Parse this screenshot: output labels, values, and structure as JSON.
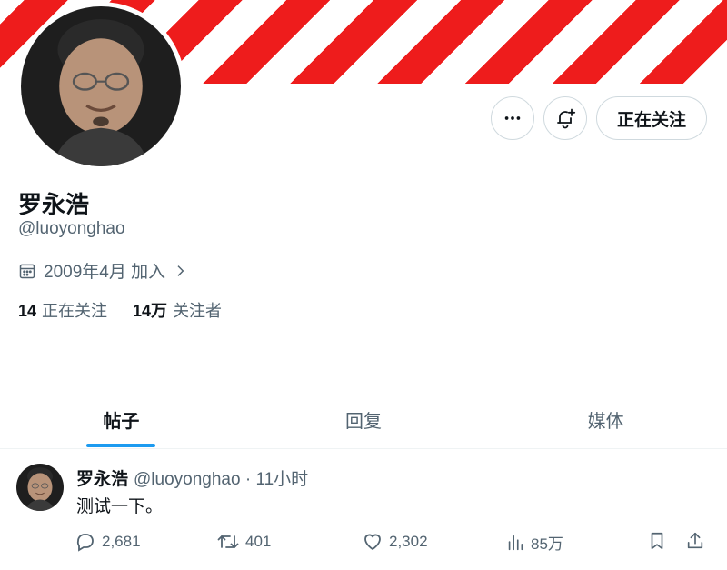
{
  "profile": {
    "name": "罗永浩",
    "handle": "@luoyonghao",
    "joined": "2009年4月 加入",
    "following_count": "14",
    "following_label": "正在关注",
    "followers_count": "14万",
    "followers_label": "关注者"
  },
  "actions": {
    "follow_label": "正在关注"
  },
  "tabs": [
    {
      "label": "帖子",
      "active": true
    },
    {
      "label": "回复",
      "active": false
    },
    {
      "label": "媒体",
      "active": false
    }
  ],
  "post": {
    "author": "罗永浩",
    "meta": "@luoyonghao · 11小时",
    "text": "测试一下。",
    "replies": "2,681",
    "reposts": "401",
    "likes": "2,302",
    "views": "85万"
  },
  "colors": {
    "banner_red": "#ee1c1c",
    "accent_blue": "#1d9bf0",
    "text_primary": "#0f1419",
    "text_secondary": "#536471"
  },
  "icons": [
    "more-icon",
    "bell-plus-icon",
    "calendar-icon",
    "chevron-right-icon",
    "reply-icon",
    "repost-icon",
    "like-icon",
    "views-icon",
    "bookmark-icon",
    "share-icon"
  ]
}
